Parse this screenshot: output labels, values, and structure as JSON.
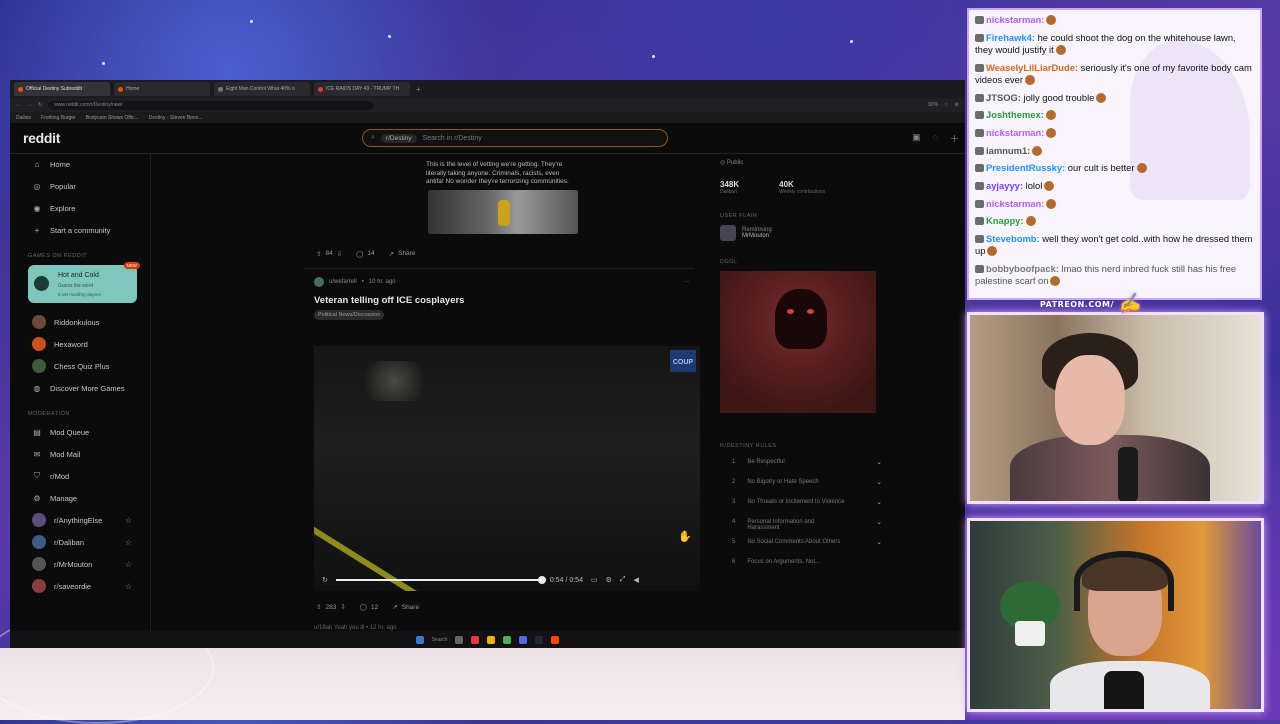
{
  "browser": {
    "tabs": [
      "Official Destiny Subreddit",
      "Home",
      "Eight Man Control What 40% o",
      "ICE RAIDS DAY 43 - TRUMP TH"
    ],
    "address": "www.reddit.com/r/Destiny/new/",
    "zoom": "90%",
    "bookmarks": [
      "Dailies",
      "Frothing Burger",
      "Bodycam Shows Offic...",
      "Destiny - Steven Bonn..."
    ]
  },
  "reddit": {
    "logo": "reddit",
    "search": {
      "chip": "r/Destiny",
      "placeholder": "Search in r/Destiny"
    },
    "sidebar": {
      "nav": [
        {
          "icon": "home-icon",
          "label": "Home"
        },
        {
          "icon": "popular-icon",
          "label": "Popular"
        },
        {
          "icon": "explore-icon",
          "label": "Explore"
        },
        {
          "icon": "plus-icon",
          "label": "Start a community"
        }
      ],
      "games_header": "GAMES ON REDDIT",
      "game_card": {
        "title": "Hot and Cold",
        "sub": "Guess the word",
        "sub2": "9.1M monthly players",
        "badge": "NEW"
      },
      "games": [
        "Riddonkulous",
        "Hexaword",
        "Chess Quiz Plus",
        "Discover More Games"
      ],
      "mod_header": "MODERATION",
      "mod": [
        "Mod Queue",
        "Mod Mail",
        "r/Mod",
        "Manage"
      ],
      "communities": [
        "r/AnythingElse",
        "r/Daliban",
        "r/MrMouton",
        "r/saveordie"
      ]
    },
    "feed": {
      "prev_post_text": "This is the level of vetting we're getting. They're literally taking anyone. Criminals, racists, even antifa! No wonder they're terrorizing communities.",
      "prev_votes": "84",
      "prev_comments": "14",
      "share": "Share",
      "post": {
        "author": "u/wefarrell",
        "age": "10 hr. ago",
        "title": "Veteran telling off ICE cosplayers",
        "flair": "Political News/Discussion",
        "video_badge": "COUP",
        "time": "0:54 / 0:54",
        "progress_pct": 100,
        "votes": "283",
        "comments": "12"
      },
      "next_author": "u/18ah",
      "next_flair": "Yeah you ill",
      "next_age": "12 hr. ago"
    },
    "right": {
      "public": "Public",
      "members": "348K",
      "members_label": "Daliban",
      "weekly": "40K",
      "weekly_label": "Weekly contributions",
      "user_flair_header": "USER FLAIR",
      "user_flair_name": "Reminising",
      "user_flair_value": "MrMouton",
      "dggl_header": "DGGL",
      "rules_header": "R/DESTINY RULES",
      "rules": [
        {
          "n": "1",
          "text": "Be Respectful"
        },
        {
          "n": "2",
          "text": "No Bigotry or Hate Speech"
        },
        {
          "n": "3",
          "text": "No Threats or Incitement to Violence"
        },
        {
          "n": "4",
          "text": "Personal Information and Harassment"
        },
        {
          "n": "5",
          "text": "No Social Comments About Others"
        },
        {
          "n": "6",
          "text": "Focus on Arguments, Not..."
        }
      ]
    }
  },
  "taskbar": {
    "search": "Search"
  },
  "chat": {
    "messages": [
      {
        "user": "nickstarman",
        "color": "#b05cff",
        "text": ""
      },
      {
        "user": "Firehawk4",
        "color": "#1e90ff",
        "text": "he could shoot the dog on the whitehouse lawn, they would justify it"
      },
      {
        "user": "WeaselyLilLiarDude",
        "color": "#d2691e",
        "text": "seriously it's one of my favorite body cam videos ever"
      },
      {
        "user": "JTSOG",
        "color": "#555555",
        "text": "jolly good trouble"
      },
      {
        "user": "Joshthemex",
        "color": "#2a9d3a",
        "text": ""
      },
      {
        "user": "nickstarman",
        "color": "#b05cff",
        "text": ""
      },
      {
        "user": "iamnum1",
        "color": "#555555",
        "text": ""
      },
      {
        "user": "PresidentRussky",
        "color": "#1e90ff",
        "text": "our cult is better"
      },
      {
        "user": "ayjayyy",
        "color": "#7a3cff",
        "text": "lolol"
      },
      {
        "user": "nickstarman",
        "color": "#b05cff",
        "text": ""
      },
      {
        "user": "Knappy",
        "color": "#2a9d3a",
        "text": ""
      },
      {
        "user": "Stevebomb",
        "color": "#1e90ff",
        "text": "well they won't get cold..with how he dressed them up"
      },
      {
        "user": "bobbyboofpack",
        "color": "#777777",
        "text": "lmao this nerd inbred fuck still has his free palestine scarf on"
      }
    ]
  },
  "overlay": {
    "patreon": "PATREON.COM/",
    "signature": "AnythingElse"
  }
}
